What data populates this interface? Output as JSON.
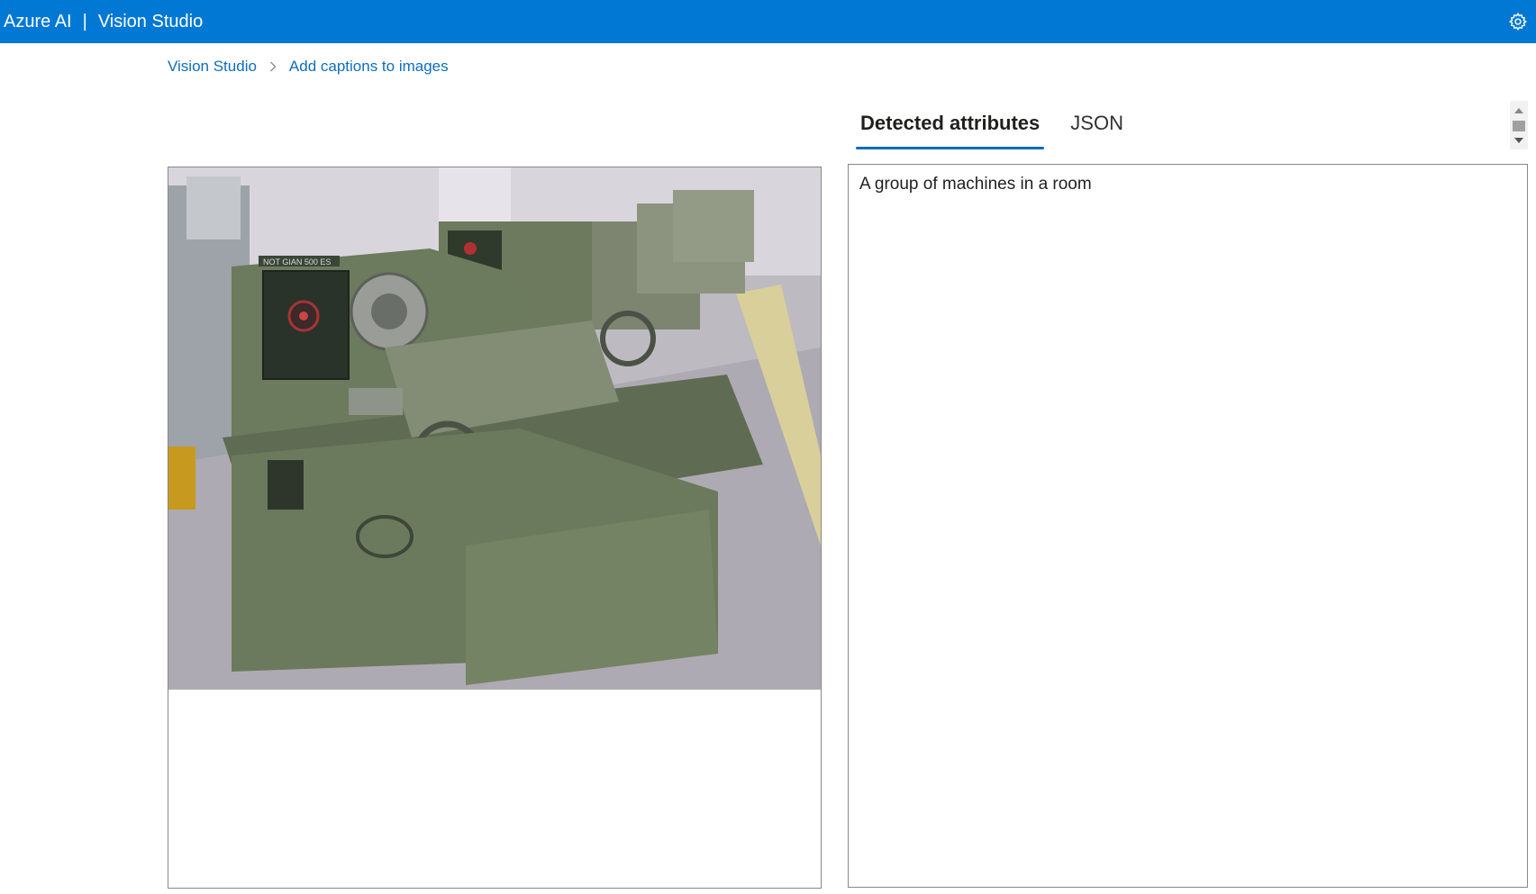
{
  "header": {
    "brand": "Azure AI",
    "separator": "|",
    "product": "Vision Studio",
    "settings_icon": "gear-icon"
  },
  "breadcrumb": {
    "items": [
      "Vision Studio",
      "Add captions to images"
    ],
    "separator_icon": "chevron-right-icon"
  },
  "tabs": [
    {
      "label": "Detected attributes",
      "active": true
    },
    {
      "label": "JSON",
      "active": false
    }
  ],
  "image_panel": {
    "image_subject": "metal lathe machines in a workshop",
    "image_lettering": "NOT GIAN 500 ES"
  },
  "result": {
    "caption": "A group of machines in a room"
  },
  "colors": {
    "brand_bar": "#0078d4",
    "link": "#0f6cbd",
    "border": "#8a8886"
  }
}
